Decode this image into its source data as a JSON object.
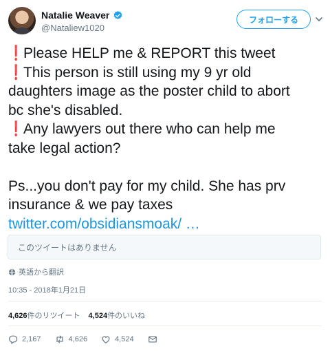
{
  "author": {
    "name": "Natalie Weaver",
    "handle": "@Nataliew1020",
    "verified": true
  },
  "follow_label": "フォローする",
  "tweet": {
    "lines": [
      "Please HELP me & REPORT this tweet",
      "This person is still using my 9 yr old",
      "daughters image as the poster child to abort",
      "bc she's disabled.",
      "Any lawyers out there who can help me",
      "take legal action?",
      "Ps...you don't pay for my child. She has prv",
      "insurance & we pay taxes"
    ],
    "link_text": "twitter.com/obsidiansmoak/ …"
  },
  "quoted_unavailable": "このツイートはありません",
  "translate_label": "英語から翻訳",
  "timestamp": "10:35 - 2018年1月21日",
  "stats": {
    "retweets_count": "4,626",
    "retweets_label": "件のリツイート",
    "likes_count": "4,524",
    "likes_label": "件のいいね"
  },
  "actions": {
    "reply_count": "2,167",
    "retweet_count": "4,626",
    "like_count": "4,524"
  },
  "colors": {
    "accent": "#1da1f2",
    "link": "#1b95e0",
    "bang": "#d0212f",
    "muted": "#657786"
  }
}
